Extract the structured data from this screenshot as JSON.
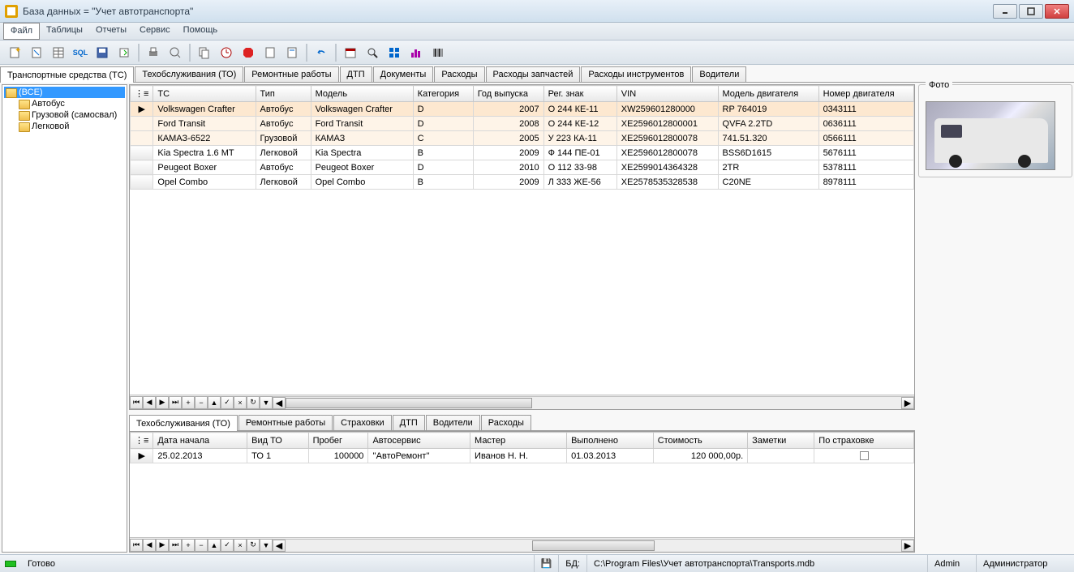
{
  "window": {
    "title": "База данных = \"Учет автотранспорта\""
  },
  "menu": {
    "file": "Файл",
    "tables": "Таблицы",
    "reports": "Отчеты",
    "service": "Сервис",
    "help": "Помощь"
  },
  "tabs": {
    "main": [
      "Транспортные средства (ТС)",
      "Техобслуживания (ТО)",
      "Ремонтные работы",
      "ДТП",
      "Документы",
      "Расходы",
      "Расходы запчастей",
      "Расходы инструментов",
      "Водители"
    ],
    "sub": [
      "Техобслуживания (ТО)",
      "Ремонтные работы",
      "Страховки",
      "ДТП",
      "Водители",
      "Расходы"
    ]
  },
  "tree": {
    "root": "(ВСЕ)",
    "items": [
      "Автобус",
      "Грузовой (самосвал)",
      "Легковой"
    ]
  },
  "grid_main": {
    "headers": [
      "ТС",
      "Тип",
      "Модель",
      "Категория",
      "Год выпуска",
      "Рег. знак",
      "VIN",
      "Модель двигателя",
      "Номер двигателя"
    ],
    "rows": [
      [
        "Volkswagen Crafter",
        "Автобус",
        "Volkswagen Crafter",
        "D",
        "2007",
        "О 244 КЕ-11",
        "XW259601280000",
        "RP 764019",
        "0343111"
      ],
      [
        "Ford Transit",
        "Автобус",
        "Ford Transit",
        "D",
        "2008",
        "О 244 КЕ-12",
        "XE2596012800001",
        "QVFA 2.2TD",
        "0636111"
      ],
      [
        "КАМАЗ-6522",
        "Грузовой",
        "КАМАЗ",
        "C",
        "2005",
        "У 223 КА-11",
        "XE2596012800078",
        "741.51.320",
        "0566111"
      ],
      [
        "Kia Spectra 1.6 MT",
        "Легковой",
        "Kia Spectra",
        "B",
        "2009",
        "Ф 144 ПЕ-01",
        "XE2596012800078",
        "BSS6D1615",
        "5676111"
      ],
      [
        "Peugeot Boxer",
        "Автобус",
        "Peugeot Boxer",
        "D",
        "2010",
        "О 112 33-98",
        "XE2599014364328",
        "2TR",
        "5378111"
      ],
      [
        "Opel Combo",
        "Легковой",
        "Opel Combo",
        "B",
        "2009",
        "Л 333 ЖЕ-56",
        "XE2578535328538",
        "C20NE",
        "8978111"
      ]
    ]
  },
  "grid_sub": {
    "headers": [
      "Дата начала",
      "Вид ТО",
      "Пробег",
      "Автосервис",
      "Мастер",
      "Выполнено",
      "Стоимость",
      "Заметки",
      "По страховке"
    ],
    "row": [
      "25.02.2013",
      "ТО 1",
      "100000",
      "''АвтоРемонт''",
      "Иванов Н. Н.",
      "01.03.2013",
      "120 000,00р.",
      ""
    ]
  },
  "right": {
    "photo": "Фото"
  },
  "status": {
    "ready": "Готово",
    "db_label": "БД:",
    "db_path": "C:\\Program Files\\Учет автотранспорта\\Transports.mdb",
    "user": "Admin",
    "role": "Администратор"
  }
}
